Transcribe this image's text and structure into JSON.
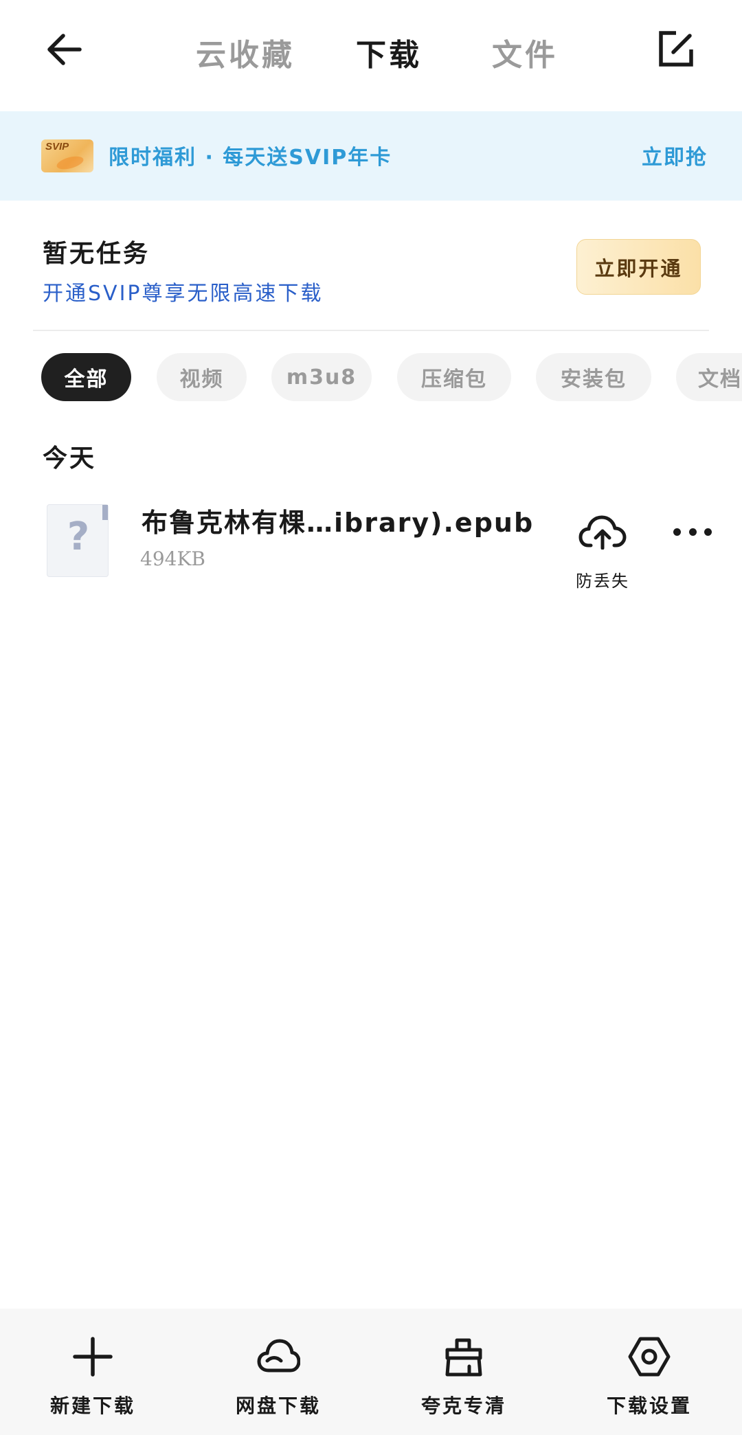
{
  "topbar": {
    "tabs": [
      {
        "label": "云收藏",
        "active": false
      },
      {
        "label": "下载",
        "active": true
      },
      {
        "label": "文件",
        "active": false
      }
    ]
  },
  "promo": {
    "badge": "SVIP",
    "text": "限时福利 · 每天送SVIP年卡",
    "action": "立即抢",
    "accent_color": "#2e9ad6"
  },
  "task_status": {
    "title": "暂无任务",
    "subtitle": "开通SVIP尊享无限高速下载",
    "button": "立即开通"
  },
  "filters": {
    "chips": [
      "全部",
      "视频",
      "m3u8",
      "压缩包",
      "安装包",
      "文档"
    ],
    "selected": "全部"
  },
  "sections": [
    {
      "heading": "今天",
      "files": [
        {
          "name": "布鲁克林有棵…ibrary).epub",
          "size": "494KB",
          "icon": "unknown-file-icon",
          "action_label": "防丢失"
        }
      ]
    }
  ],
  "bottombar": {
    "items": [
      {
        "label": "新建下载",
        "icon": "plus-icon"
      },
      {
        "label": "网盘下载",
        "icon": "cloud-icon"
      },
      {
        "label": "夸克专清",
        "icon": "broom-icon"
      },
      {
        "label": "下载设置",
        "icon": "settings-hex-icon"
      }
    ]
  }
}
